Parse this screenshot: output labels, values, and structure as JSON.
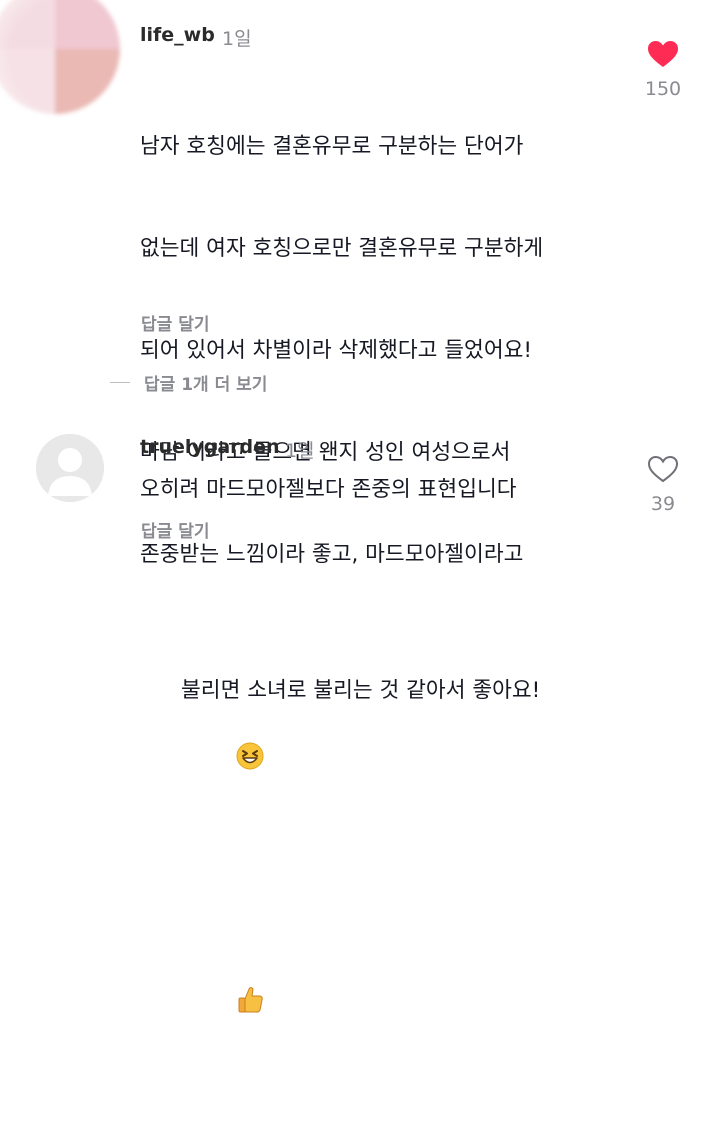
{
  "comments": [
    {
      "username": "life_wb",
      "time": "1일",
      "lines": [
        "남자 호칭에는 결혼유무로 구분하는 단어가",
        "없는데 여자 호칭으로만 결혼유무로 구분하게",
        "되어 있어서 차별이라 삭제했다고 들었어요!",
        "마담 이라고 들으면 왠지 성인 여성으로서",
        "존중받는 느낌이라 좋고, 마드모아젤이라고",
        "불리면 소녀로 불리는 것 같아서 좋아요!"
      ],
      "emojis": [
        "grinning-squinting-face",
        "thumbs-up"
      ],
      "like_count": "150",
      "liked": true,
      "reply_label": "답글 달기"
    },
    {
      "username": "truelygarden",
      "time": "1일",
      "text": "오히려 마드모아젤보다 존중의 표현입니다",
      "like_count": "39",
      "liked": false,
      "reply_label": "답글 달기"
    }
  ],
  "view_more_replies": "답글 1개 더 보기",
  "colors": {
    "like_active": "#fe2c55",
    "muted": "#8a8b91",
    "text": "#161823"
  }
}
